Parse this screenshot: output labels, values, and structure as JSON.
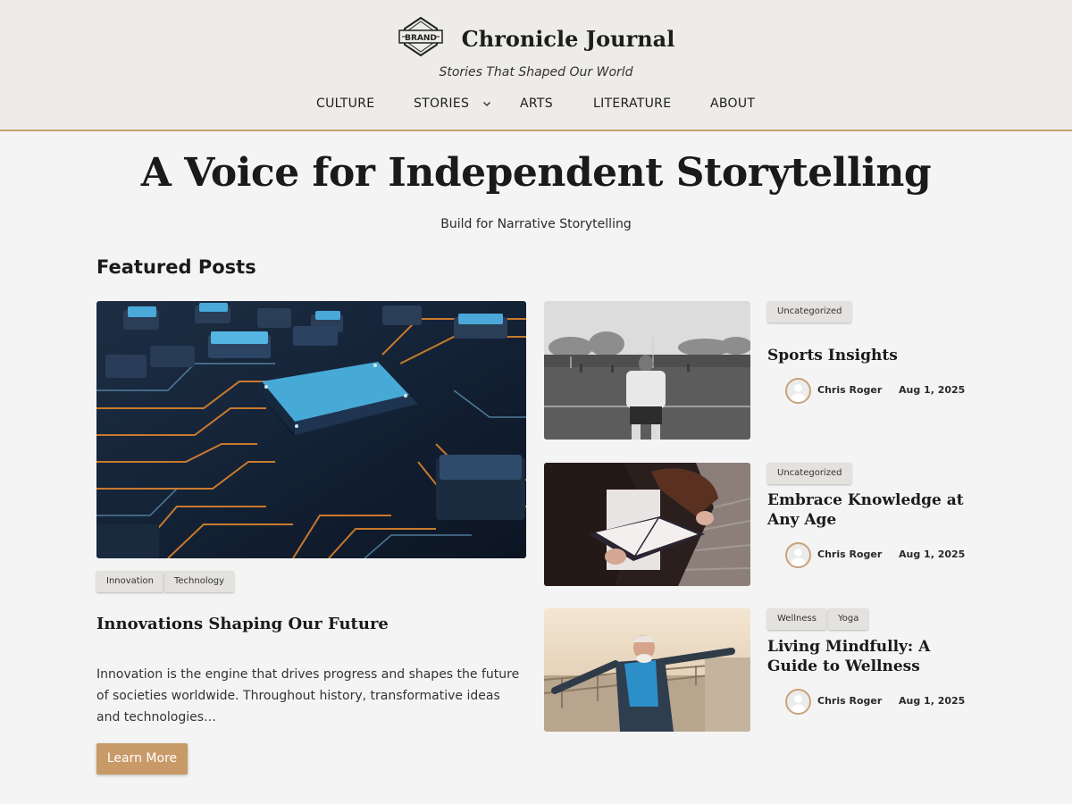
{
  "site": {
    "logo_text": "BRAND",
    "title": "Chronicle Journal",
    "tagline": "Stories That Shaped Our World"
  },
  "nav": {
    "items": [
      "CULTURE",
      "STORIES",
      "ARTS",
      "LITERATURE",
      "ABOUT"
    ]
  },
  "hero": {
    "title": "A Voice for Independent Storytelling",
    "subtitle": "Build for Narrative Storytelling"
  },
  "featured": {
    "section_title": "Featured Posts",
    "main": {
      "tags": [
        "Innovation",
        "Technology"
      ],
      "title": "Innovations Shaping Our Future",
      "excerpt": "Innovation is the engine that drives progress and shapes the future of societies worldwide. Throughout history, transformative ideas and technologies…",
      "button": "Learn More"
    },
    "posts": [
      {
        "tags": [
          "Uncategorized"
        ],
        "title": "Sports Insights",
        "author": "Chris Roger",
        "date": "Aug 1, 2025"
      },
      {
        "tags": [
          "Uncategorized"
        ],
        "title": "Embrace Knowledge at Any Age",
        "author": "Chris Roger",
        "date": "Aug 1, 2025"
      },
      {
        "tags": [
          "Wellness",
          "Yoga"
        ],
        "title": "Living Mindfully: A Guide to Wellness",
        "author": "Chris Roger",
        "date": "Aug 1, 2025"
      }
    ]
  },
  "colors": {
    "accent": "#c89a68",
    "header_bg": "#eeece8",
    "page_bg": "#f4f4f4",
    "divider": "#c8a36e"
  },
  "icons": {
    "logo": "brand-badge-icon",
    "nav_dropdown": "chevron-down-icon",
    "avatar": "user-avatar-icon"
  }
}
